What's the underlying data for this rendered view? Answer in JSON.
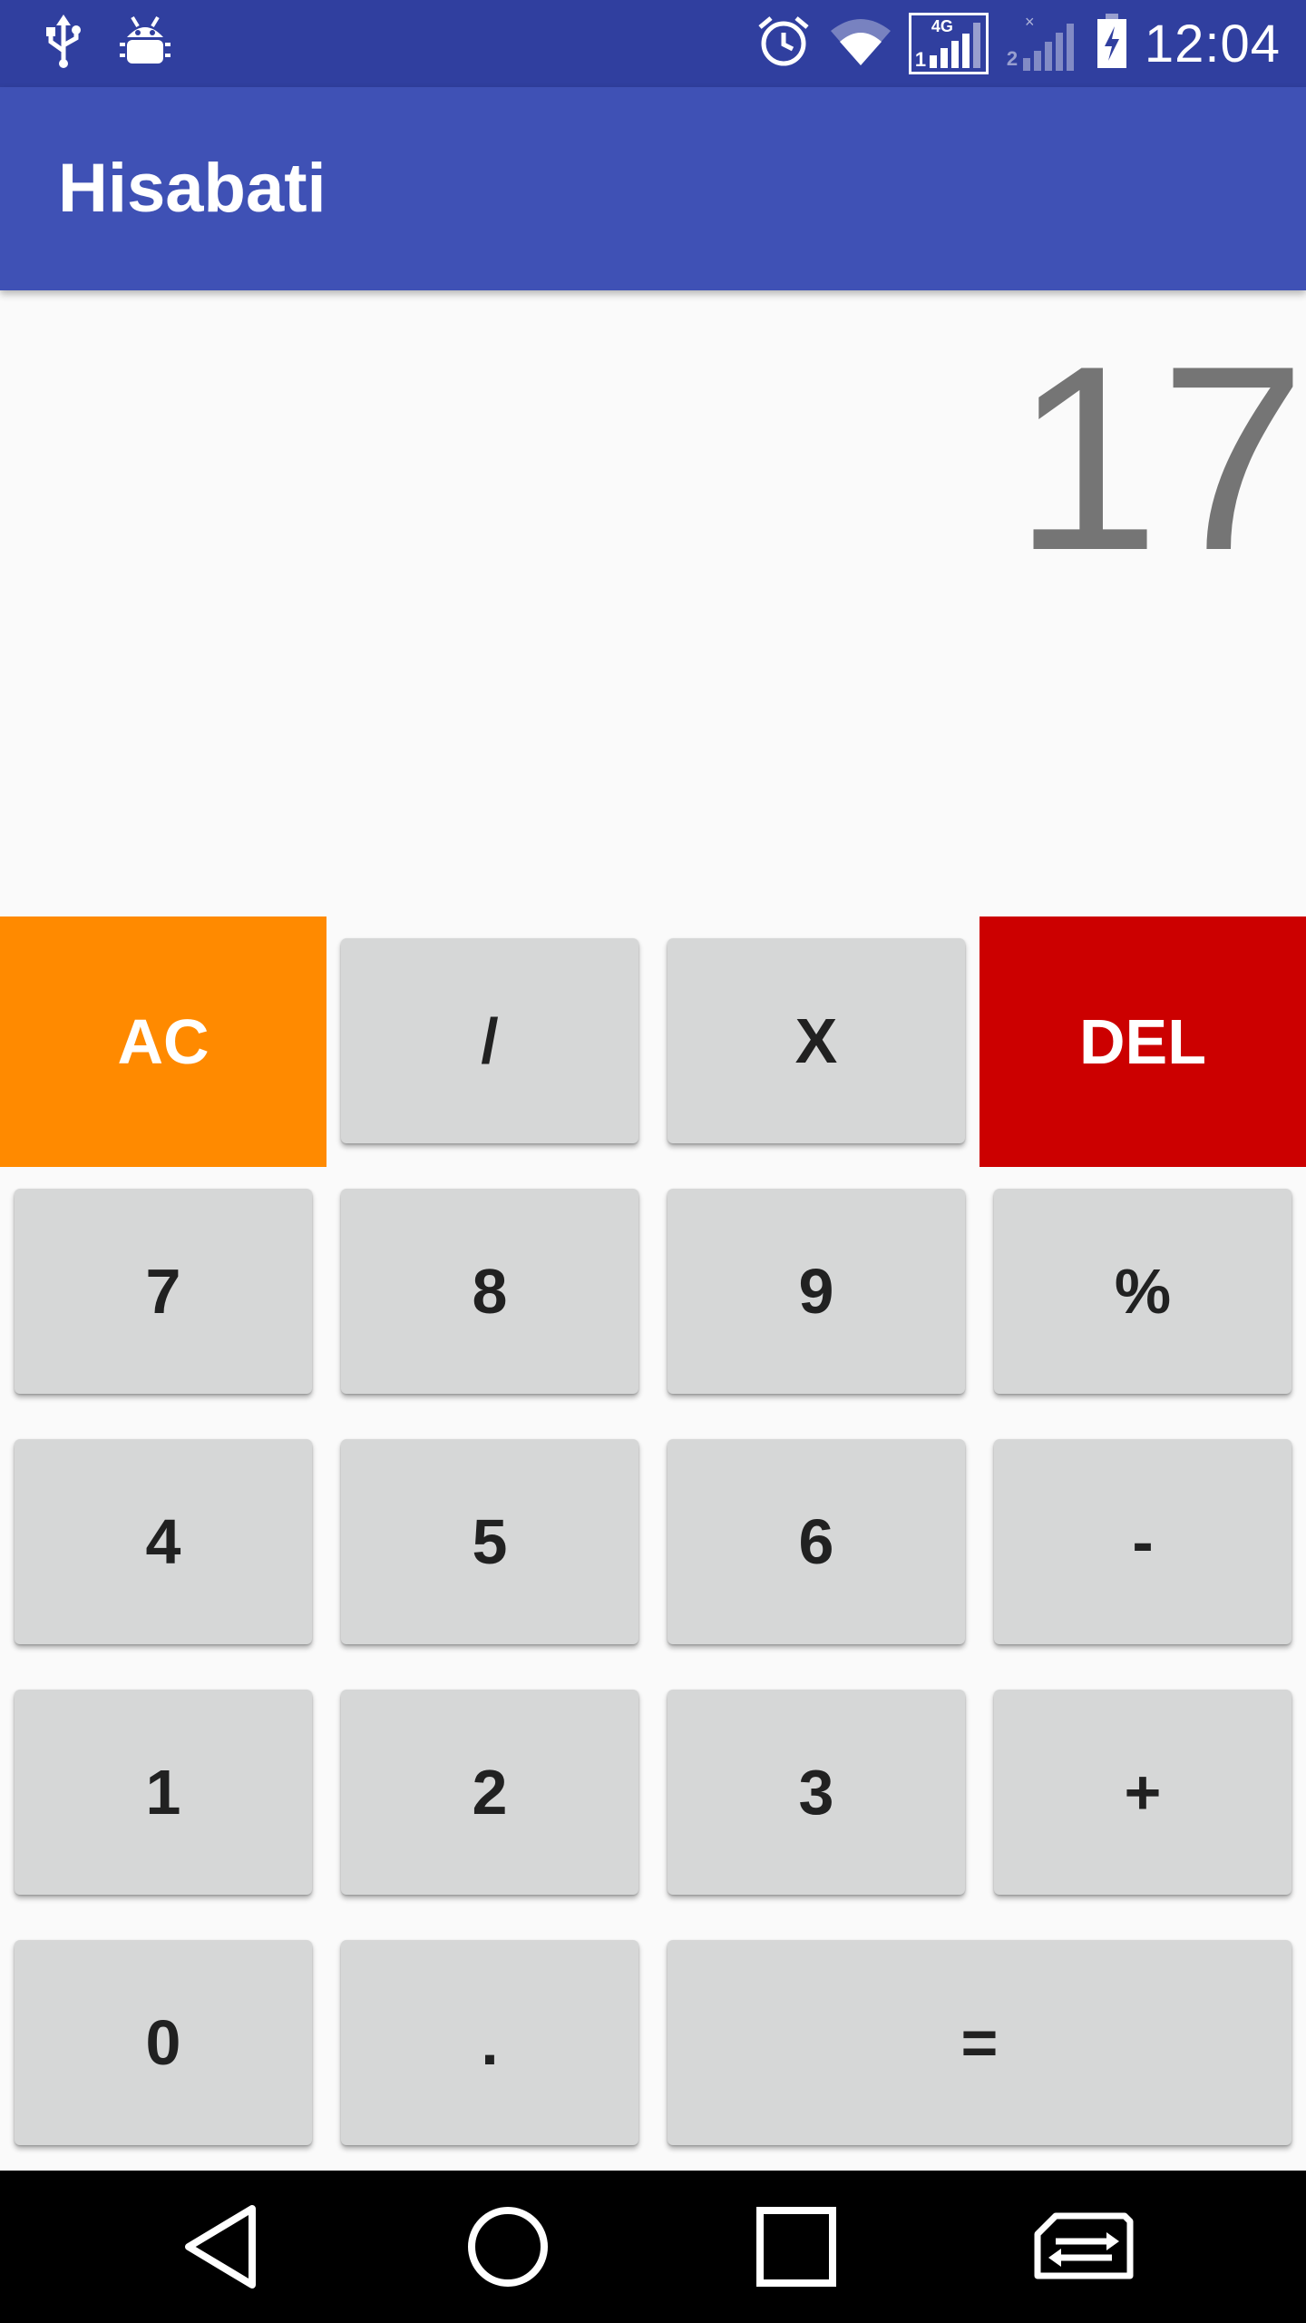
{
  "status_bar": {
    "time": "12:04",
    "network_type": "4G",
    "sim1_label": "1",
    "sim2_label": "2",
    "icons": [
      "usb-icon",
      "android-debug-icon",
      "alarm-icon",
      "wifi-icon",
      "signal-sim1-icon",
      "signal-sim2-icon",
      "battery-charging-icon"
    ]
  },
  "app_bar": {
    "title": "Hisabati"
  },
  "display": {
    "value": "17"
  },
  "keys": {
    "ac": "AC",
    "divide": "/",
    "multiply": "X",
    "del": "DEL",
    "seven": "7",
    "eight": "8",
    "nine": "9",
    "percent": "%",
    "four": "4",
    "five": "5",
    "six": "6",
    "minus": "-",
    "one": "1",
    "two": "2",
    "three": "3",
    "plus": "+",
    "zero": "0",
    "dot": ".",
    "equals": "="
  },
  "nav_bar": {
    "icons": [
      "back-icon",
      "home-icon",
      "recents-icon",
      "sim-switch-icon"
    ]
  },
  "colors": {
    "status_bar": "#303f9f",
    "app_bar": "#3f51b5",
    "ac_button": "#ff8a00",
    "del_button": "#cc0000",
    "key_bg": "#d6d7d7",
    "display_text": "#757575"
  }
}
